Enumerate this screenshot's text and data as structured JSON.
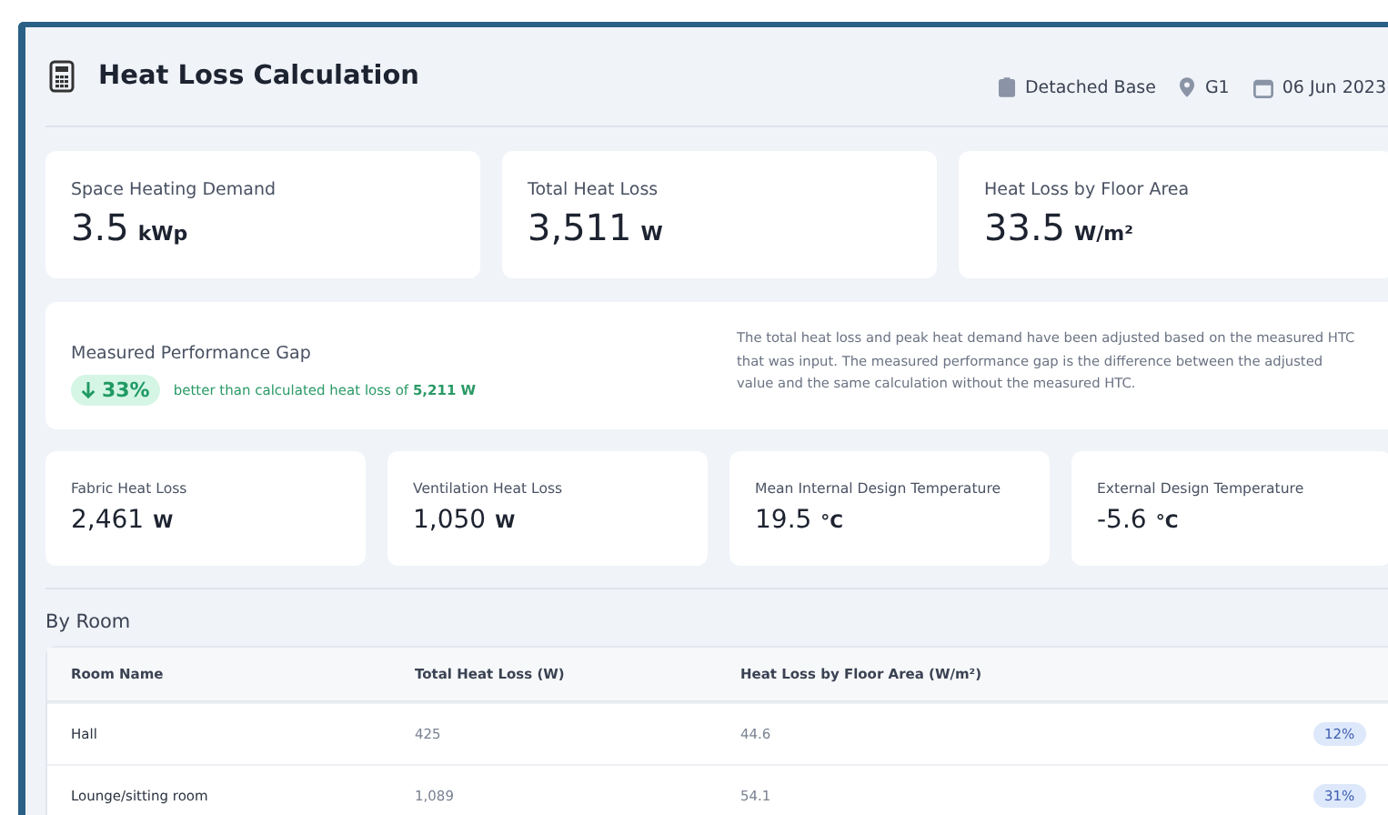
{
  "header": {
    "title": "Heat Loss Calculation",
    "meta": [
      {
        "kind": "house",
        "text": "Detached Base"
      },
      {
        "kind": "pin",
        "text": "G1"
      },
      {
        "kind": "date",
        "text": "06 Jun 2023"
      }
    ]
  },
  "summary": [
    {
      "label": "Space Heating Demand",
      "value": "3.5",
      "unit": "kWp"
    },
    {
      "label": "Total Heat Loss",
      "value": "3,511",
      "unit": "W"
    },
    {
      "label": "Heat Loss by Floor Area",
      "value": "33.5",
      "unit": "W/m²"
    }
  ],
  "performance_gap": {
    "label": "Measured Performance Gap",
    "badge": "33%",
    "note": "better than calculated heat loss of **5,211 W**",
    "explanation": "The total heat loss and peak heat demand have been adjusted based on the measured HTC that was input. The measured performance gap is the difference between the adjusted value and the same calculation without the measured HTC."
  },
  "details": [
    {
      "label": "Fabric Heat Loss",
      "value": "2,461",
      "unit": "W"
    },
    {
      "label": "Ventilation Heat Loss",
      "value": "1,050",
      "unit": "W"
    },
    {
      "label": "Mean Internal Design Temperature",
      "value": "19.5",
      "unit": "°C"
    },
    {
      "label": "External Design Temperature",
      "value": "-5.6",
      "unit": "°C"
    }
  ],
  "by_room": {
    "title": "By Room",
    "columns": [
      "Room Name",
      "Total Heat Loss (W)",
      "Heat Loss by Floor Area (W/m²)"
    ],
    "rows": [
      {
        "room": "Hall",
        "total": "425",
        "per_area": "44.6",
        "column_4": "12%"
      },
      {
        "room": "Lounge/sitting room",
        "total": "1,089",
        "per_area": "54.1",
        "column_4": "31%"
      }
    ]
  }
}
